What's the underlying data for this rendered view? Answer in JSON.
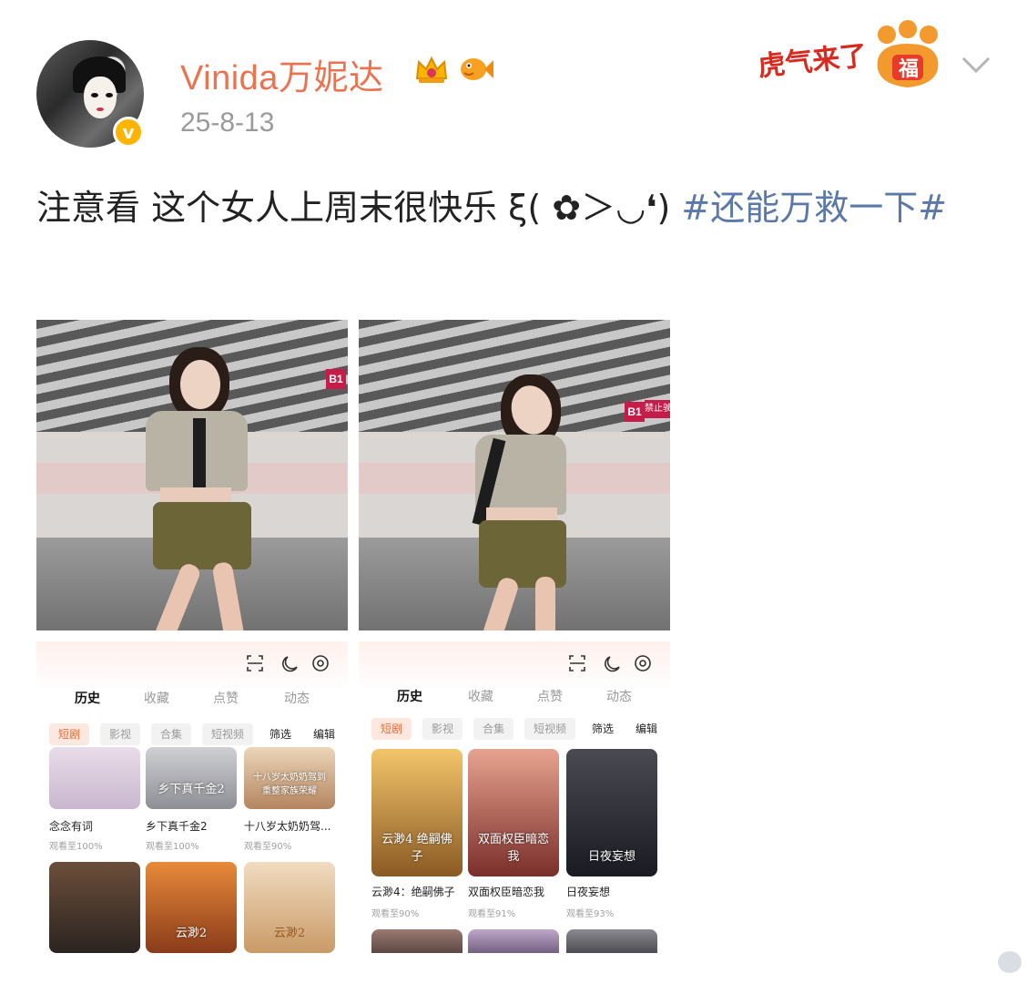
{
  "post": {
    "username": "Vinida万妮达",
    "date": "25-8-13",
    "text_main": "注意看 这个女人上周末很快乐 ξ( ✿＞◡❛) ",
    "hashtag": "#还能万救一下#",
    "sticker_text": "虎气来了",
    "sticker_badge": "福",
    "verified_badge": "v"
  },
  "icons": [
    "crown-icon",
    "fish-emoji-icon",
    "paw-sticker-icon",
    "chevron-down-icon",
    "scan-icon",
    "moon-icon",
    "settings-icon"
  ],
  "colors": {
    "username": "#eb7350",
    "hashtag": "#5a78a8",
    "date": "#9a9a9a",
    "chip_active": "#ef6b3b"
  },
  "photos": [
    {
      "sign": "B1"
    },
    {
      "sign": "B1",
      "sign_extra": "禁止驶入"
    }
  ],
  "screens": [
    {
      "tabs": [
        "历史",
        "收藏",
        "点赞",
        "动态"
      ],
      "active_tab": "历史",
      "chips": [
        "短剧",
        "影视",
        "合集",
        "短视频"
      ],
      "active_chip": "短剧",
      "actions": [
        "筛选",
        "编辑"
      ],
      "cards": [
        {
          "title": "念念有词",
          "progress": "观看至100%",
          "poster_text": ""
        },
        {
          "title": "乡下真千金2",
          "progress": "观看至100%",
          "poster_text": "乡下真千金2"
        },
        {
          "title": "十八岁太奶奶驾...",
          "progress": "观看至90%",
          "poster_text": "十八岁太奶奶驾到 重整家族荣耀"
        },
        {
          "title": "",
          "progress": "",
          "poster_text": ""
        },
        {
          "title": "",
          "progress": "",
          "poster_text": "云渺2"
        },
        {
          "title": "",
          "progress": "",
          "poster_text": "云渺2"
        }
      ]
    },
    {
      "tabs": [
        "历史",
        "收藏",
        "点赞",
        "动态"
      ],
      "active_tab": "历史",
      "chips": [
        "短剧",
        "影视",
        "合集",
        "短视频"
      ],
      "active_chip": "短剧",
      "actions": [
        "筛选",
        "编辑"
      ],
      "cards": [
        {
          "title": "云渺4：绝嗣佛子",
          "progress": "观看至90%",
          "poster_text": "云渺4 绝嗣佛子"
        },
        {
          "title": "双面权臣暗恋我",
          "progress": "观看至91%",
          "poster_text": "双面权臣暗恋我"
        },
        {
          "title": "日夜妄想",
          "progress": "观看至93%",
          "poster_text": "日夜妄想"
        }
      ]
    }
  ]
}
